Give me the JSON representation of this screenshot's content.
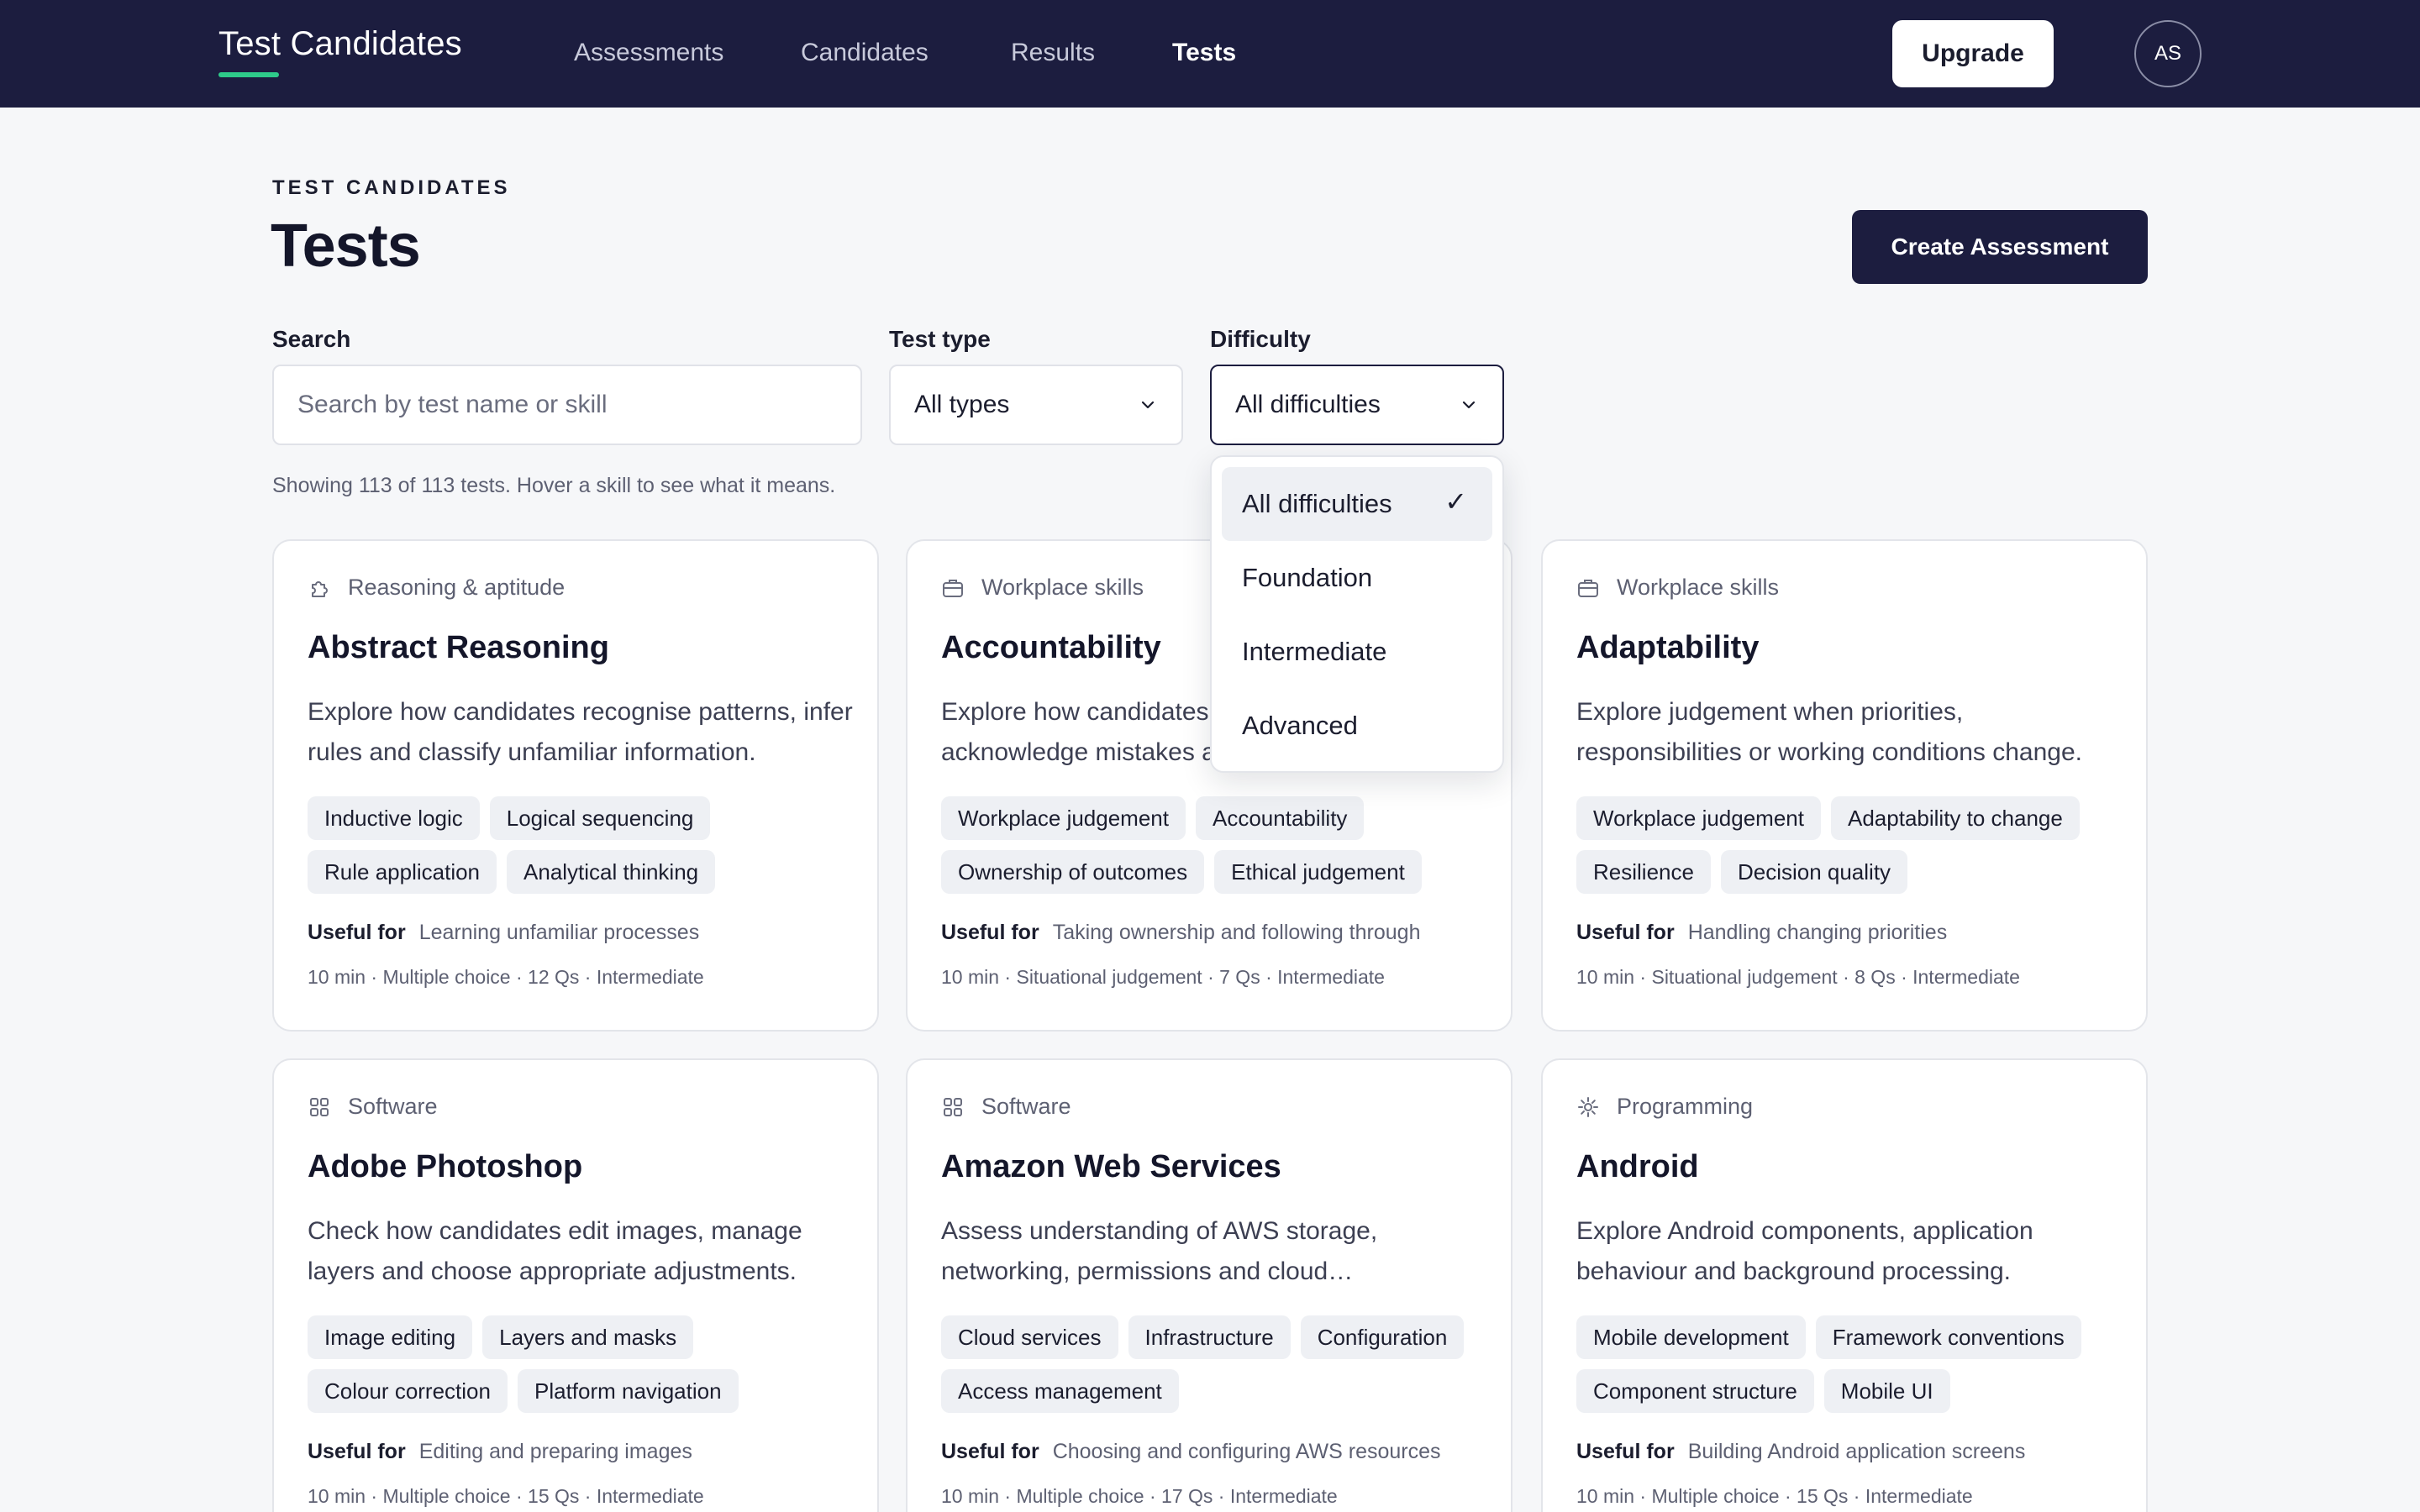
{
  "nav": {
    "brand": "Test Candidates",
    "links": [
      "Assessments",
      "Candidates",
      "Results",
      "Tests"
    ],
    "active_link": "Tests",
    "upgrade_label": "Upgrade",
    "avatar_initials": "AS",
    "accent_color": "#2ecb8a",
    "bar_color": "#1c1d3f"
  },
  "header": {
    "eyebrow": "TEST CANDIDATES",
    "title": "Tests",
    "create_label": "Create Assessment"
  },
  "filters": {
    "search_label": "Search",
    "search_placeholder": "Search by test name or skill",
    "type_label": "Test type",
    "type_value": "All types",
    "difficulty_label": "Difficulty",
    "difficulty_value": "All difficulties",
    "results_note": "Showing 113 of 113 tests. Hover a skill to see what it means."
  },
  "difficulty_dropdown": {
    "options": [
      "All difficulties",
      "Foundation",
      "Intermediate",
      "Advanced"
    ],
    "selected": "All difficulties",
    "check_glyph": "✓"
  },
  "useful_for_label": "Useful for",
  "cards": [
    {
      "icon": "puzzle-icon",
      "category": "Reasoning & aptitude",
      "title": "Abstract Reasoning",
      "description": "Explore how candidates recognise patterns, infer rules and classify unfamiliar information.",
      "tags": [
        "Inductive logic",
        "Logical sequencing",
        "Rule application",
        "Analytical thinking"
      ],
      "useful_for": "Learning unfamiliar processes",
      "meta": "10 min · Multiple choice · 12 Qs · Intermediate"
    },
    {
      "icon": "briefcase-icon",
      "category": "Workplace skills",
      "title": "Accountability",
      "description": "Explore how candidates take ownership, acknowledge mistakes and follow through.",
      "tags": [
        "Workplace judgement",
        "Accountability",
        "Ownership of outcomes",
        "Ethical judgement"
      ],
      "useful_for": "Taking ownership and following through",
      "meta": "10 min · Situational judgement · 7 Qs · Intermediate"
    },
    {
      "icon": "briefcase-icon",
      "category": "Workplace skills",
      "title": "Adaptability",
      "description": "Explore judgement when priorities, responsibilities or working conditions change.",
      "tags": [
        "Workplace judgement",
        "Adaptability to change",
        "Resilience",
        "Decision quality"
      ],
      "useful_for": "Handling changing priorities",
      "meta": "10 min · Situational judgement · 8 Qs · Intermediate"
    },
    {
      "icon": "grid-icon",
      "category": "Software",
      "title": "Adobe Photoshop",
      "description": "Check how candidates edit images, manage layers and choose appropriate adjustments.",
      "tags": [
        "Image editing",
        "Layers and masks",
        "Colour correction",
        "Platform navigation"
      ],
      "useful_for": "Editing and preparing images",
      "meta": "10 min · Multiple choice · 15 Qs · Intermediate"
    },
    {
      "icon": "grid-icon",
      "category": "Software",
      "title": "Amazon Web Services",
      "description": "Assess understanding of AWS storage, networking, permissions and cloud…",
      "tags": [
        "Cloud services",
        "Infrastructure",
        "Configuration",
        "Access management"
      ],
      "useful_for": "Choosing and configuring AWS resources",
      "meta": "10 min · Multiple choice · 17 Qs · Intermediate"
    },
    {
      "icon": "gear-icon",
      "category": "Programming",
      "title": "Android",
      "description": "Explore Android components, application behaviour and background processing.",
      "tags": [
        "Mobile development",
        "Framework conventions",
        "Component structure",
        "Mobile UI"
      ],
      "useful_for": "Building Android application screens",
      "meta": "10 min · Multiple choice · 15 Qs · Intermediate"
    }
  ]
}
